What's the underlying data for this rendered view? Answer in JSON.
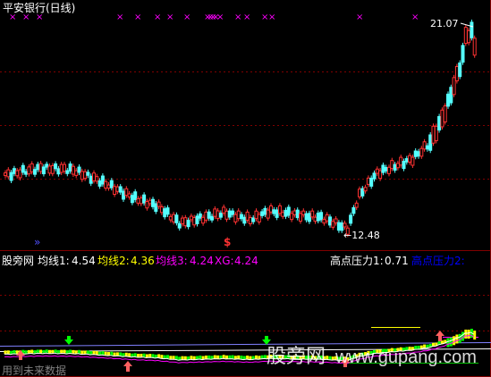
{
  "window": {
    "title": "平安银行(日线)",
    "price_high_label": "21.07",
    "price_low_label": "←12.48",
    "signal_marker": "$",
    "collapse_arrows": "»"
  },
  "indicator": {
    "name": "股旁网",
    "ma1_label": "均线1:",
    "ma1_value": "4.54",
    "ma2_label": "均线2:",
    "ma2_value": "4.36",
    "ma3_label": "均线3:",
    "ma3_value": "4.24",
    "xg_label": "XG:",
    "xg_value": "4.24",
    "pressure1_label": "高点压力1:",
    "pressure1_value": "0.71",
    "pressure2_label": "高点压力2:",
    "footer_note": "用到未来数据"
  },
  "watermark": {
    "cn": "股旁网",
    "url": "www.gupang.com"
  },
  "colors": {
    "background": "#000000",
    "up_candle": "#ff3232",
    "down_candle": "#54ffff",
    "cross_marks": "#ff00ff",
    "ma1": "#ffffff",
    "ma2": "#ffff00",
    "ma3": "#ff00ff",
    "pressure2": "#0000ff",
    "grid": "#800000"
  }
}
